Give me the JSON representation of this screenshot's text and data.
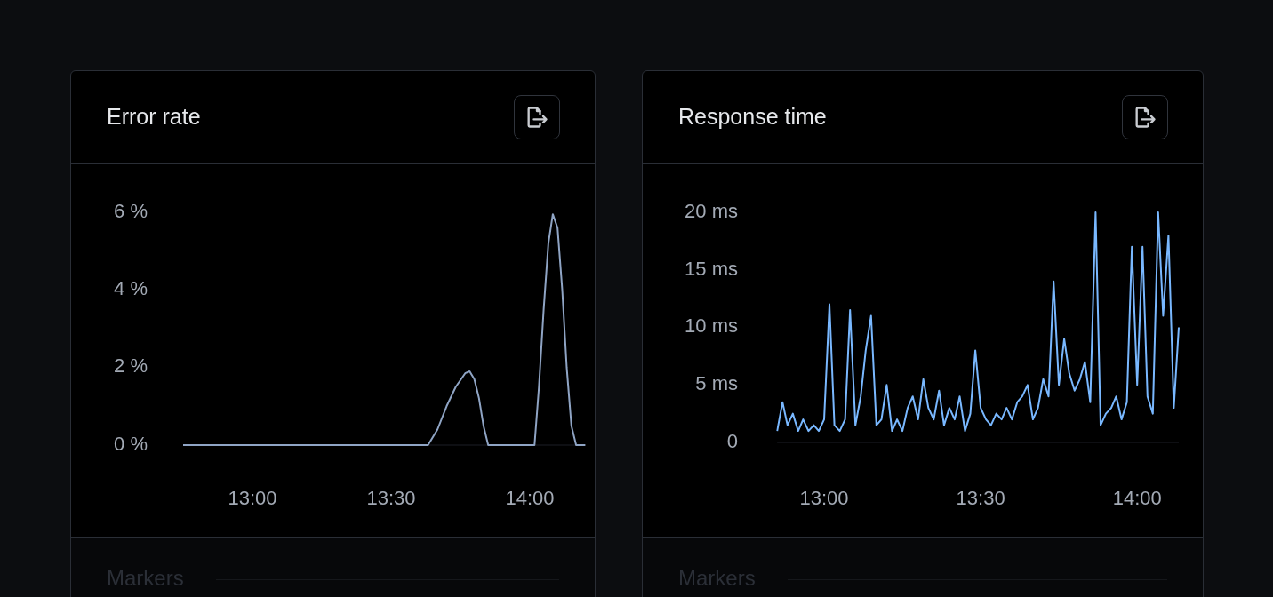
{
  "cards": [
    {
      "title": "Error rate",
      "footer": "Markers",
      "chart_data": {
        "type": "line",
        "x": [
          12.75,
          13.633,
          13.667,
          13.7,
          13.733,
          13.767,
          13.783,
          13.8,
          13.817,
          13.833,
          13.85,
          14.017,
          14.033,
          14.05,
          14.067,
          14.083,
          14.1,
          14.117,
          14.133,
          14.15,
          14.167,
          14.2
        ],
        "xlim": [
          12.75,
          14.2
        ],
        "ylim": [
          0,
          6
        ],
        "xticks": [
          {
            "value": 13,
            "label": "13:00"
          },
          {
            "value": 13.5,
            "label": "13:30"
          },
          {
            "value": 14,
            "label": "14:00"
          }
        ],
        "yticks": [
          {
            "value": 0,
            "label": "0 %"
          },
          {
            "value": 2,
            "label": "2 %"
          },
          {
            "value": 4,
            "label": "4 %"
          },
          {
            "value": 6,
            "label": "6 %"
          }
        ],
        "series": [
          {
            "color": "#8fa4c4",
            "values": [
              0,
              0,
              0.4,
              1,
              1.5,
              1.85,
              1.9,
              1.7,
              1.2,
              0.5,
              0,
              0,
              1.5,
              3.5,
              5.2,
              5.95,
              5.6,
              4,
              2,
              0.5,
              0,
              0
            ]
          }
        ]
      }
    },
    {
      "title": "Response time",
      "footer": "Markers",
      "chart_data": {
        "type": "line",
        "x": [
          12.85,
          12.867,
          12.883,
          12.9,
          12.917,
          12.933,
          12.95,
          12.967,
          12.983,
          13,
          13.017,
          13.033,
          13.05,
          13.067,
          13.083,
          13.1,
          13.117,
          13.133,
          13.15,
          13.167,
          13.183,
          13.2,
          13.217,
          13.233,
          13.25,
          13.267,
          13.283,
          13.3,
          13.317,
          13.333,
          13.35,
          13.367,
          13.383,
          13.4,
          13.417,
          13.433,
          13.45,
          13.467,
          13.483,
          13.5,
          13.517,
          13.533,
          13.55,
          13.567,
          13.583,
          13.6,
          13.617,
          13.633,
          13.65,
          13.667,
          13.683,
          13.7,
          13.717,
          13.733,
          13.75,
          13.767,
          13.783,
          13.8,
          13.817,
          13.833,
          13.85,
          13.867,
          13.883,
          13.9,
          13.917,
          13.933,
          13.95,
          13.967,
          13.983,
          14,
          14.017,
          14.033,
          14.05,
          14.067,
          14.083,
          14.1,
          14.117,
          14.133
        ],
        "xlim": [
          12.85,
          14.133
        ],
        "ylim": [
          0,
          20
        ],
        "xticks": [
          {
            "value": 13,
            "label": "13:00"
          },
          {
            "value": 13.5,
            "label": "13:30"
          },
          {
            "value": 14,
            "label": "14:00"
          }
        ],
        "yticks": [
          {
            "value": 0,
            "label": "0"
          },
          {
            "value": 5,
            "label": "5 ms"
          },
          {
            "value": 10,
            "label": "10 ms"
          },
          {
            "value": 15,
            "label": "15 ms"
          },
          {
            "value": 20,
            "label": "20 ms"
          }
        ],
        "series": [
          {
            "color": "#79b8ff",
            "values": [
              1,
              3.5,
              1.5,
              2.5,
              1,
              2,
              1,
              1.5,
              1,
              2,
              12,
              1.5,
              1,
              2,
              11.5,
              1.5,
              4,
              8,
              11,
              1.5,
              2,
              5,
              1,
              2,
              1,
              3,
              4,
              2,
              5.5,
              3,
              2,
              4.5,
              1.5,
              3,
              2,
              4,
              1,
              2.5,
              8,
              3,
              2,
              1.5,
              2.5,
              2,
              3,
              2,
              3.5,
              4,
              5,
              2,
              3,
              5.5,
              4,
              14,
              5,
              9,
              6,
              4.5,
              5.5,
              7,
              3.5,
              20,
              1.5,
              2.5,
              3,
              4,
              2,
              3.5,
              17,
              5,
              17,
              4,
              2.5,
              20,
              11,
              18,
              3,
              10
            ]
          }
        ]
      }
    }
  ]
}
